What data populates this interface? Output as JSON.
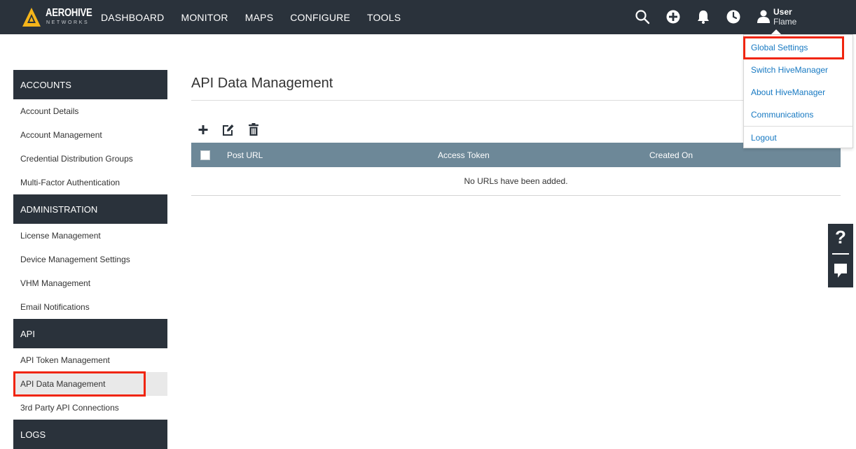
{
  "brand": {
    "name": "AEROHIVE",
    "tagline": "NETWORKS",
    "accent_color": "#f5b51a"
  },
  "nav": {
    "items": [
      "DASHBOARD",
      "MONITOR",
      "MAPS",
      "CONFIGURE",
      "TOOLS"
    ]
  },
  "header_icons": [
    "search-icon",
    "add-icon",
    "bell-icon",
    "clock-icon",
    "user-icon"
  ],
  "user": {
    "label": "User",
    "name": "Flame"
  },
  "user_menu": {
    "items": [
      "Global Settings",
      "Switch HiveManager",
      "About HiveManager",
      "Communications",
      "Logout"
    ]
  },
  "sidebar": {
    "sections": [
      {
        "title": "ACCOUNTS",
        "items": [
          "Account Details",
          "Account Management",
          "Credential Distribution Groups",
          "Multi-Factor Authentication"
        ]
      },
      {
        "title": "ADMINISTRATION",
        "items": [
          "License Management",
          "Device Management Settings",
          "VHM Management",
          "Email Notifications"
        ]
      },
      {
        "title": "API",
        "items": [
          "API Token Management",
          "API Data Management",
          "3rd Party API Connections"
        ]
      },
      {
        "title": "LOGS",
        "items": []
      }
    ],
    "active_item": "API Data Management"
  },
  "main": {
    "title": "API Data Management",
    "toolbar": [
      "add-icon",
      "edit-icon",
      "delete-icon"
    ],
    "table": {
      "columns": [
        "Post URL",
        "Access Token",
        "Created On"
      ],
      "empty_message": "No URLs have been added."
    }
  },
  "help": {
    "question_mark": "?"
  },
  "colors": {
    "topbar": "#2a323b",
    "table_header": "#6d8898",
    "link": "#1779c2",
    "highlight": "#f0250e"
  }
}
